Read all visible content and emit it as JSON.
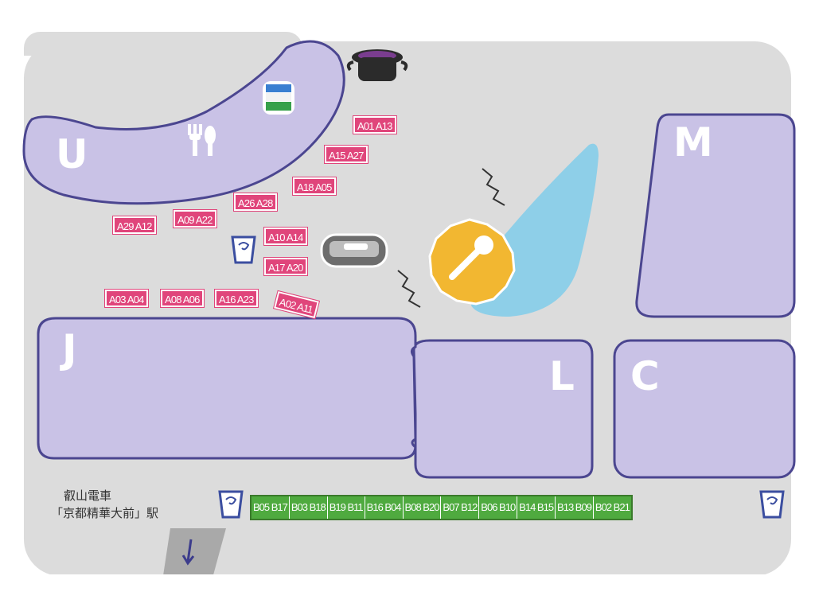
{
  "areas": {
    "u": "U",
    "m": "M",
    "j": "J",
    "l": "L",
    "c": "C"
  },
  "stalls_a": [
    "A01 A13",
    "A15 A27",
    "A18 A05",
    "A26 A28",
    "A09 A22",
    "A29 A12",
    "A10 A14",
    "A17 A20",
    "A03 A04",
    "A08 A06",
    "A16 A23",
    "A02 A11"
  ],
  "stalls_b": [
    "B05 B17",
    "B03 B18",
    "B19 B11",
    "B16 B04",
    "B08 B20",
    "B07 B12",
    "B06 B10",
    "B14 B15",
    "B13 B09",
    "B02 B21"
  ],
  "station": {
    "line1": "叡山電車",
    "line2": "「京都精華大前」駅"
  },
  "icons": {
    "food": "fork-knife-icon",
    "stage": "microphone-icon",
    "trash": "trash-bin-icon",
    "pot": "cooking-pot-icon",
    "flag": "flag-badge-icon",
    "arrow": "down-arrow-icon"
  },
  "colors": {
    "ground": "#dcdcdc",
    "block_fill": "#c9c2e6",
    "block_border": "#4b4690",
    "stall_a": "#e0457b",
    "stall_b": "#4faa3f",
    "pond": "#8ecfe8",
    "stage": "#f2b731"
  }
}
